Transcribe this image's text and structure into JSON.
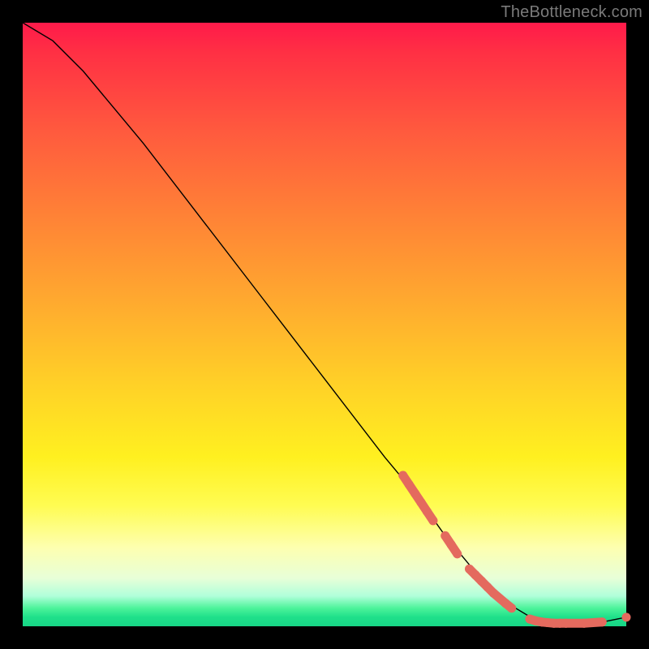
{
  "watermark": "TheBottleneck.com",
  "chart_data": {
    "type": "line",
    "title": "",
    "xlabel": "",
    "ylabel": "",
    "xlim": [
      0,
      100
    ],
    "ylim": [
      0,
      100
    ],
    "grid": false,
    "legend": false,
    "background_gradient": {
      "top": "#ff1a4a",
      "mid": "#ffd127",
      "bottom": "#17d686"
    },
    "curve": {
      "name": "bottleneck-curve",
      "x": [
        0,
        5,
        10,
        20,
        30,
        40,
        50,
        60,
        65,
        70,
        75,
        80,
        85,
        90,
        95,
        100
      ],
      "y": [
        100,
        97,
        92,
        80,
        67,
        54,
        41,
        28,
        22,
        15,
        9,
        4,
        1,
        0.5,
        0.5,
        1.5
      ]
    },
    "marker_series": {
      "name": "highlighted-points",
      "color": "#e46a5e",
      "points": [
        {
          "x": 63,
          "y": 25
        },
        {
          "x": 64,
          "y": 23.5
        },
        {
          "x": 65,
          "y": 22
        },
        {
          "x": 66,
          "y": 20.5
        },
        {
          "x": 67,
          "y": 19
        },
        {
          "x": 68,
          "y": 17.5
        },
        {
          "x": 70,
          "y": 15
        },
        {
          "x": 71,
          "y": 13.5
        },
        {
          "x": 72,
          "y": 12
        },
        {
          "x": 74,
          "y": 9.5
        },
        {
          "x": 75,
          "y": 8.5
        },
        {
          "x": 76,
          "y": 7.5
        },
        {
          "x": 77,
          "y": 6.5
        },
        {
          "x": 78,
          "y": 5.5
        },
        {
          "x": 80,
          "y": 3.8
        },
        {
          "x": 81,
          "y": 3.0
        },
        {
          "x": 84,
          "y": 1.2
        },
        {
          "x": 85,
          "y": 0.9
        },
        {
          "x": 86,
          "y": 0.7
        },
        {
          "x": 87,
          "y": 0.6
        },
        {
          "x": 88,
          "y": 0.5
        },
        {
          "x": 89,
          "y": 0.5
        },
        {
          "x": 90,
          "y": 0.5
        },
        {
          "x": 93,
          "y": 0.5
        },
        {
          "x": 96,
          "y": 0.7
        },
        {
          "x": 100,
          "y": 1.5
        }
      ]
    }
  }
}
